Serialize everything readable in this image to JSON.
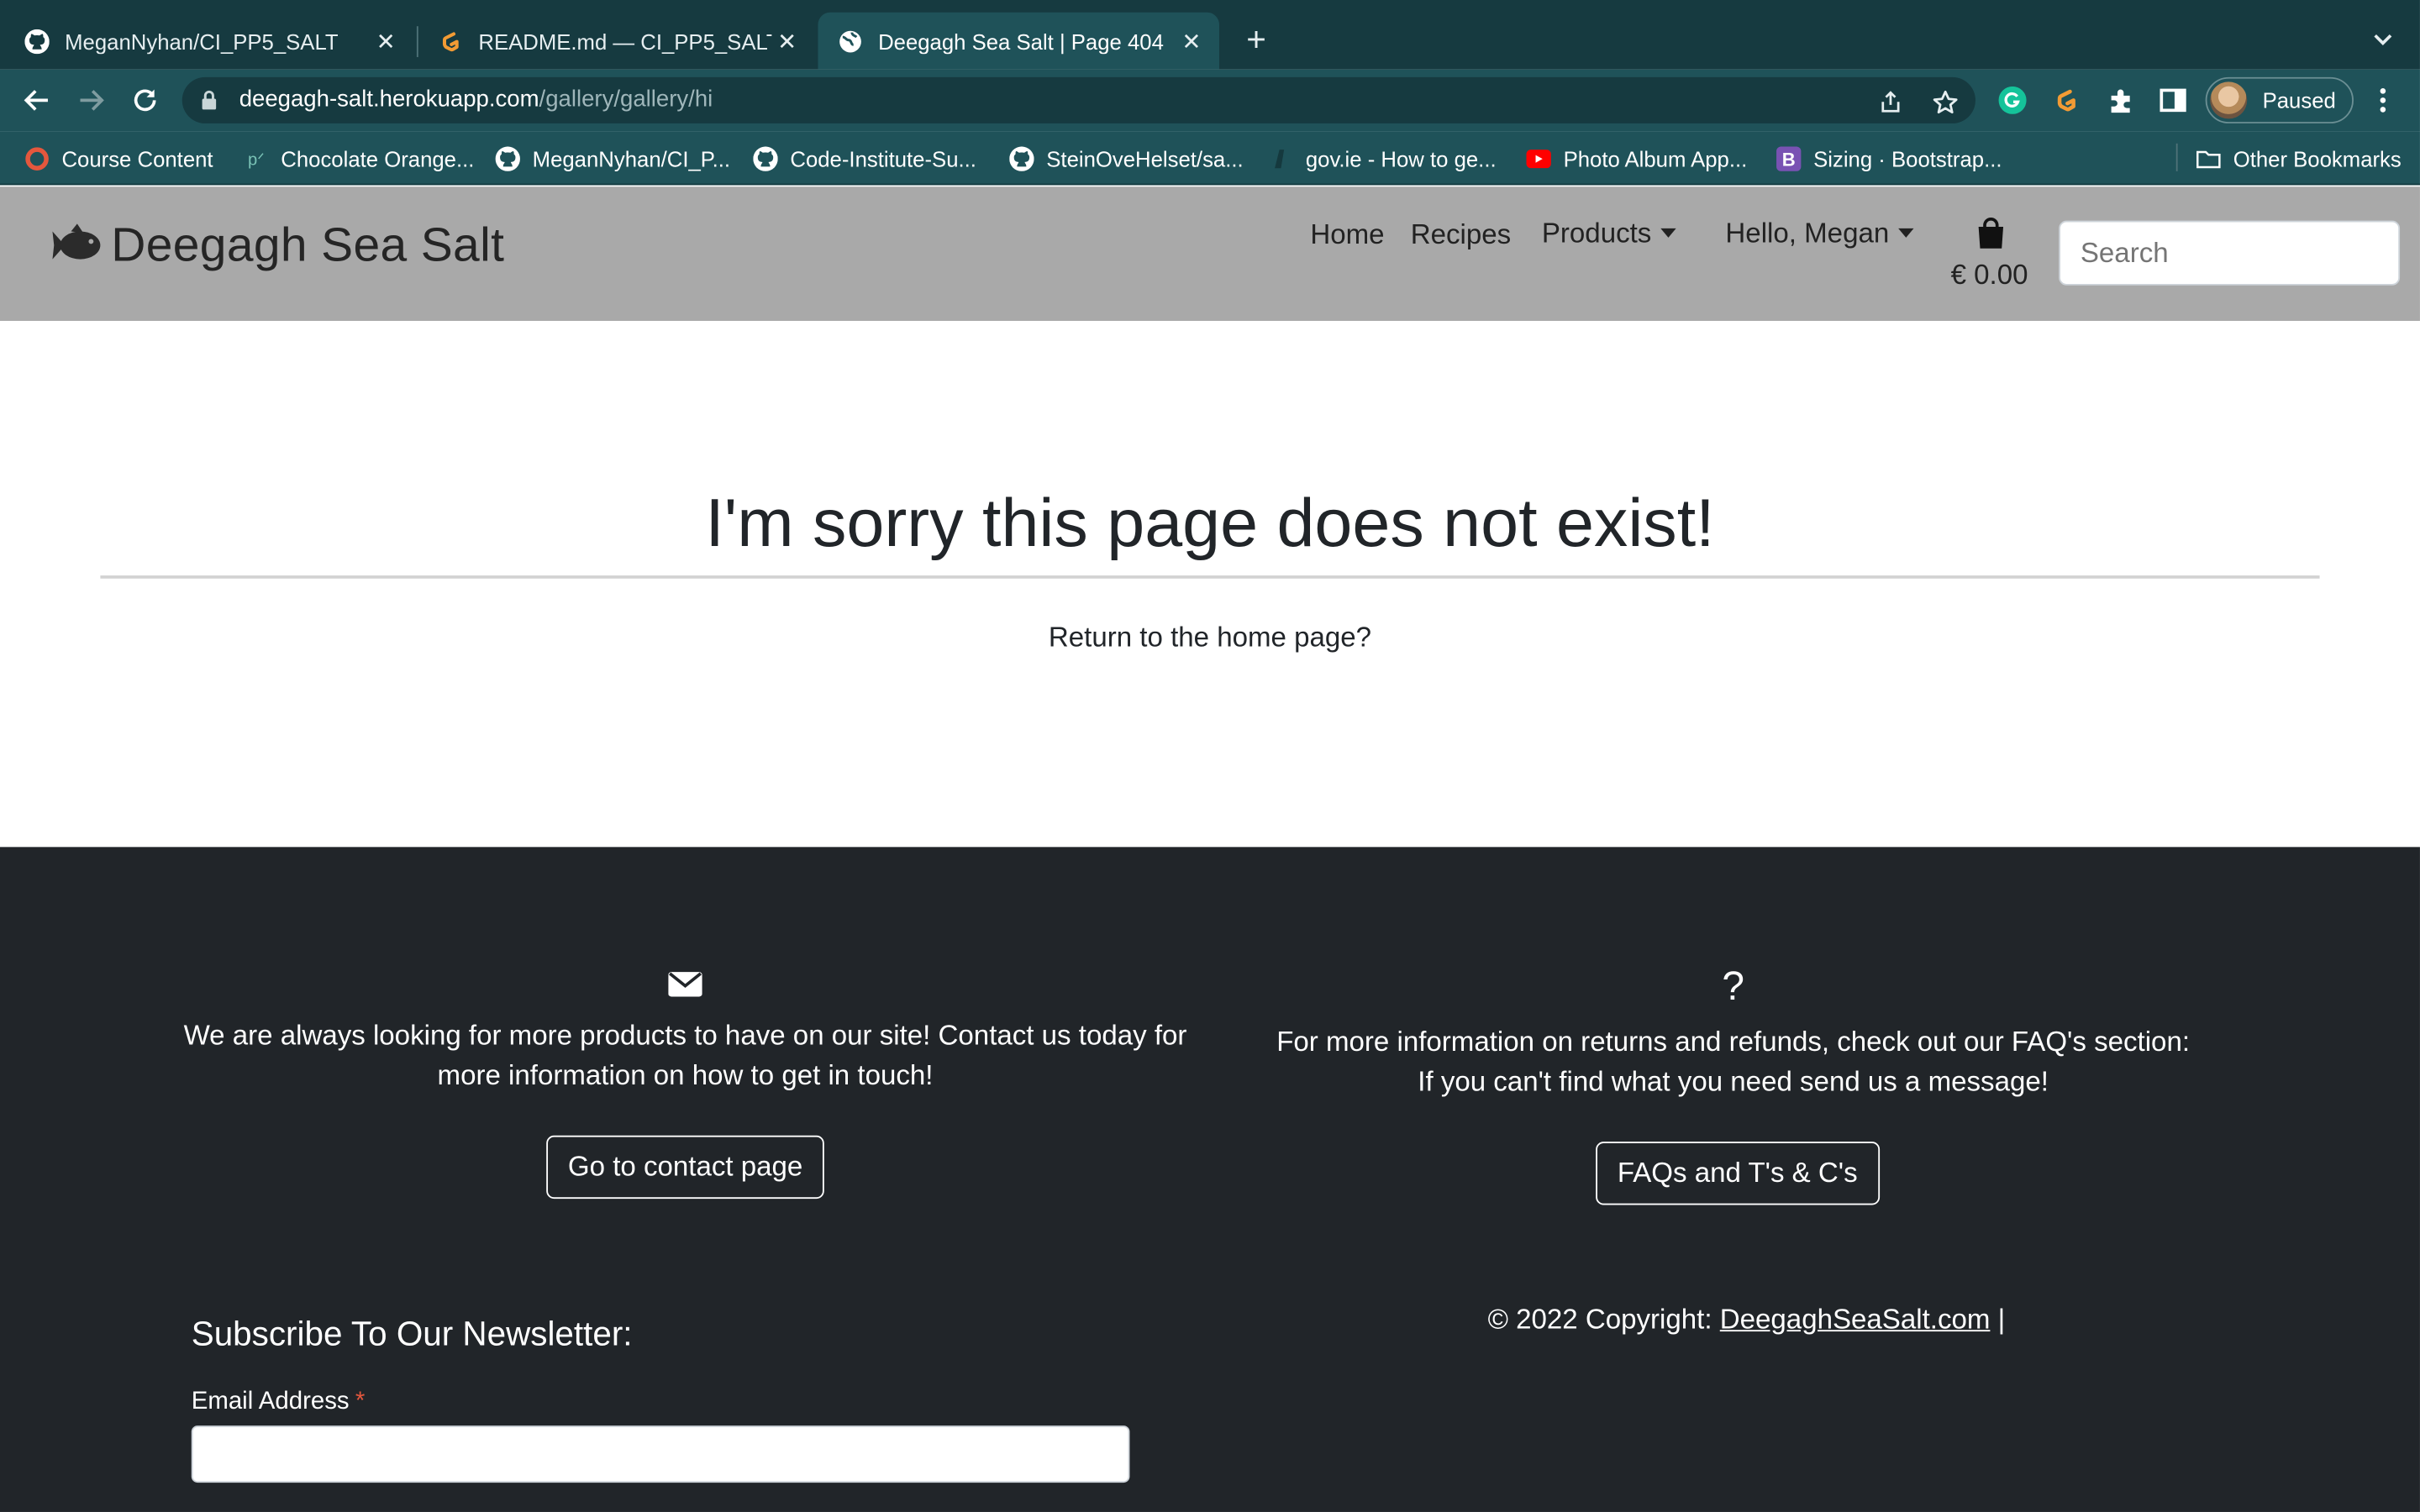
{
  "browser": {
    "tabs": [
      {
        "title": "MeganNyhan/CI_PP5_SALT",
        "icon": "github-icon",
        "active": false
      },
      {
        "title": "README.md — CI_PP5_SALT — ",
        "icon": "gitpod-icon",
        "active": false
      },
      {
        "title": "Deegagh Sea Salt | Page 404",
        "icon": "globe-icon",
        "active": true
      }
    ],
    "url_host": "deegagh-salt.herokuapp.com",
    "url_path": "/gallery/gallery/hi",
    "profile_label": "Paused",
    "bookmarks": [
      {
        "label": "Course Content",
        "icon": "ring-icon"
      },
      {
        "label": "Chocolate Orange...",
        "icon": "p-icon"
      },
      {
        "label": "MeganNyhan/CI_P...",
        "icon": "github-icon"
      },
      {
        "label": "Code-Institute-Su...",
        "icon": "github-icon"
      },
      {
        "label": "SteinOveHelset/sa...",
        "icon": "github-icon"
      },
      {
        "label": "gov.ie - How to ge...",
        "icon": "harp-icon"
      },
      {
        "label": "Photo Album App...",
        "icon": "youtube-icon"
      },
      {
        "label": "Sizing · Bootstrap...",
        "icon": "bootstrap-icon"
      }
    ],
    "other_bookmarks": "Other Bookmarks"
  },
  "site": {
    "brand": "Deegagh Sea Salt",
    "nav": {
      "home": "Home",
      "recipes": "Recipes",
      "products": "Products",
      "account": "Hello, Megan"
    },
    "cart_total": "€ 0.00",
    "search_placeholder": "Search"
  },
  "main": {
    "title": "I'm sorry this page does not exist!",
    "home_link": "Return to the home page?"
  },
  "footer": {
    "contact_text": "We are always looking for more products to have on our site! Contact us today for more information on how to get in touch!",
    "contact_button": "Go to contact page",
    "faq_icon": "?",
    "faq_text_1": "For more information on returns and refunds, check out our FAQ's section:",
    "faq_text_2": "If you can't find what you need send us a message!",
    "faq_button": "FAQs and T's & C's",
    "newsletter_title": "Subscribe To Our Newsletter:",
    "email_label": "Email Address",
    "email_required_mark": "*",
    "copyright_prefix": "© 2022 Copyright:",
    "copyright_link": "DeegaghSeaSalt.com",
    "copyright_suffix": "|"
  }
}
